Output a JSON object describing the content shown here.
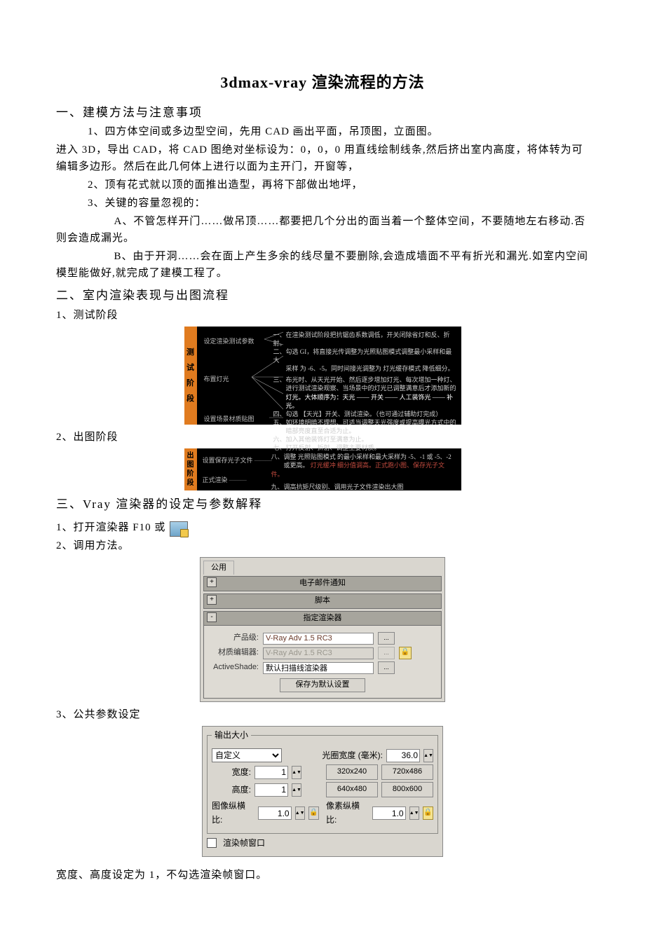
{
  "title": "3dmax-vray 渲染流程的方法",
  "sec1": {
    "heading": "一、建模方法与注意事项",
    "p1": "1、四方体空间或多边型空间，先用 CAD 画出平面，吊顶图，立面图。",
    "p2": "进入 3D，导出 CAD，将 CAD 图绝对坐标设为：0，0，0 用直线绘制线条,然后挤出室内高度，将体转为可编辑多边形。然后在此几何体上进行以面为主开门，开窗等，",
    "p3": "2、顶有花式就以顶的面推出造型，再将下部做出地坪，",
    "p4": "3、关键的容量忽视的：",
    "pA": "A、不管怎样开门……做吊顶……都要把几个分出的面当着一个整体空间，不要随地左右移动.否则会造成漏光。",
    "pB": "B、由于开洞……会在面上产生多余的线尽量不要删除,会造成墙面不平有折光和漏光.如室内空间模型能做好,就完成了建模工程了。"
  },
  "sec2": {
    "heading": "二、室内渲染表现与出图流程",
    "step1": "1、测试阶段",
    "step2": "2、出图阶段"
  },
  "fig1": {
    "sidebar": "测试阶段",
    "lbl1": "设定渲染测试参数",
    "lbl2": "布置灯光",
    "lbl3": "设置场景材质贴图",
    "t1": "一、在渲染测试阶段把抗锯齿系数调低，开关闭除省灯和反、折射。",
    "t2a": "二、勾选 GI，将直接光传调整为光照贴图模式调整最小采样和最大",
    "t2b": "采样 为 -6、-5。同时间接光调整为 灯光缓存模式 降低细分。",
    "t3a": "三、布光时、从天光开始、然后逐步增加灯光、每次增加一种灯、",
    "t3b": "进行测试渲染观察、当场景中的灯光已调整满意后才添加新的",
    "t3c": "灯光。大体顺序为：天光 —— 开关 —— 人工装饰光 —— 补光。",
    "t4": "四、勾选           【天光】开关、测试渲染。（也可通过辅助灯完成）",
    "t5a": "五、如环境明暗不理想、可适当调整天光强度或提高曝光方式中的",
    "t5b": "暗部亮度直至合适为止。",
    "t6": "六、加入其他装饰灯至满意为止。",
    "t7": "七、打开反射、折射、调整主要材质。"
  },
  "fig2": {
    "sidebar": "出图阶段",
    "lbl1": "设置保存光子文件",
    "lbl2": "正式渲染",
    "t1a": "八、调整 光照贴图模式 的最小采样和最大采样为 -5、-1 或 -5、-2",
    "t1b_pre": "或更高。",
    "t1b_red": "灯光缓冲",
    "t1b_post": " 细分值调高。正式跑小图、保存光子文件。",
    "t2": "九、调高抗矩尺级别、调用光子文件渲染出大图"
  },
  "sec3": {
    "heading": "三、Vray 渲染器的设定与参数解释",
    "p1_pre": "1、打开渲染器    F10 或",
    "p2": "2、调用方法。",
    "p3": "3、公共参数设定"
  },
  "fig3": {
    "tab": "公用",
    "roll1": "电子邮件通知",
    "roll2": "脚本",
    "roll3": "指定渲染器",
    "lbl_prod": "产品级:",
    "lbl_mat": "材质编辑器:",
    "lbl_as": "ActiveShade:",
    "val_prod": "V-Ray Adv 1.5 RC3",
    "val_mat": "V-Ray Adv 1.5 RC3",
    "val_as": "默认扫描线渲染器",
    "save_btn": "保存为默认设置"
  },
  "fig4": {
    "legend": "输出大小",
    "custom": "自定义",
    "aperture_lbl": "光圈宽度 (毫米):",
    "aperture_val": "36.0",
    "width_lbl": "宽度:",
    "height_lbl": "高度:",
    "width_val": "1",
    "height_val": "1",
    "preset1": "320x240",
    "preset2": "720x486",
    "preset3": "640x480",
    "preset4": "800x600",
    "imgaspect_lbl": "图像纵横比:",
    "imgaspect_val": "1.0",
    "pixaspect_lbl": "像素纵横比:",
    "pixaspect_val": "1.0",
    "render_window": "渲染帧窗口"
  },
  "footer": "宽度、高度设定为 1，不勾选渲染帧窗口。"
}
